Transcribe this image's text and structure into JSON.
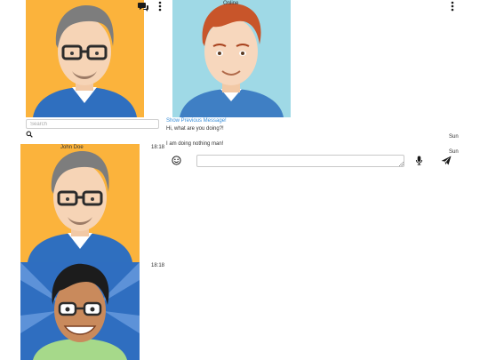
{
  "header": {
    "contact_status": "Online"
  },
  "sidebar": {
    "search": {
      "placeholder": "Search",
      "value": ""
    },
    "contacts": [
      {
        "name": "John Doe",
        "time": "18:18"
      },
      {
        "name": "",
        "time": "18:18"
      }
    ]
  },
  "conversation": {
    "show_previous_label": "Show Previous Message!",
    "messages": [
      {
        "text": "Hi, what are you doing?!",
        "time": "Sun"
      },
      {
        "text": "I am doing nothing man!",
        "time": "Sun"
      }
    ]
  },
  "reply": {
    "value": "",
    "placeholder": ""
  },
  "icons": {
    "new_chat": "comments-icon",
    "sidebar_menu": "vertical-ellipsis-icon",
    "conversation_menu": "vertical-ellipsis-icon",
    "search": "search-icon",
    "emoji": "smiley-icon",
    "mic": "microphone-icon",
    "send": "paper-plane-icon"
  },
  "colors": {
    "avatar_orange_bg": "#fbb33c",
    "avatar_teal_bg": "#9fd9e6",
    "avatar_blue_bg": "#2f6ec0",
    "sweater_blue": "#2f6fbf",
    "link_blue": "#3a8ed8"
  }
}
